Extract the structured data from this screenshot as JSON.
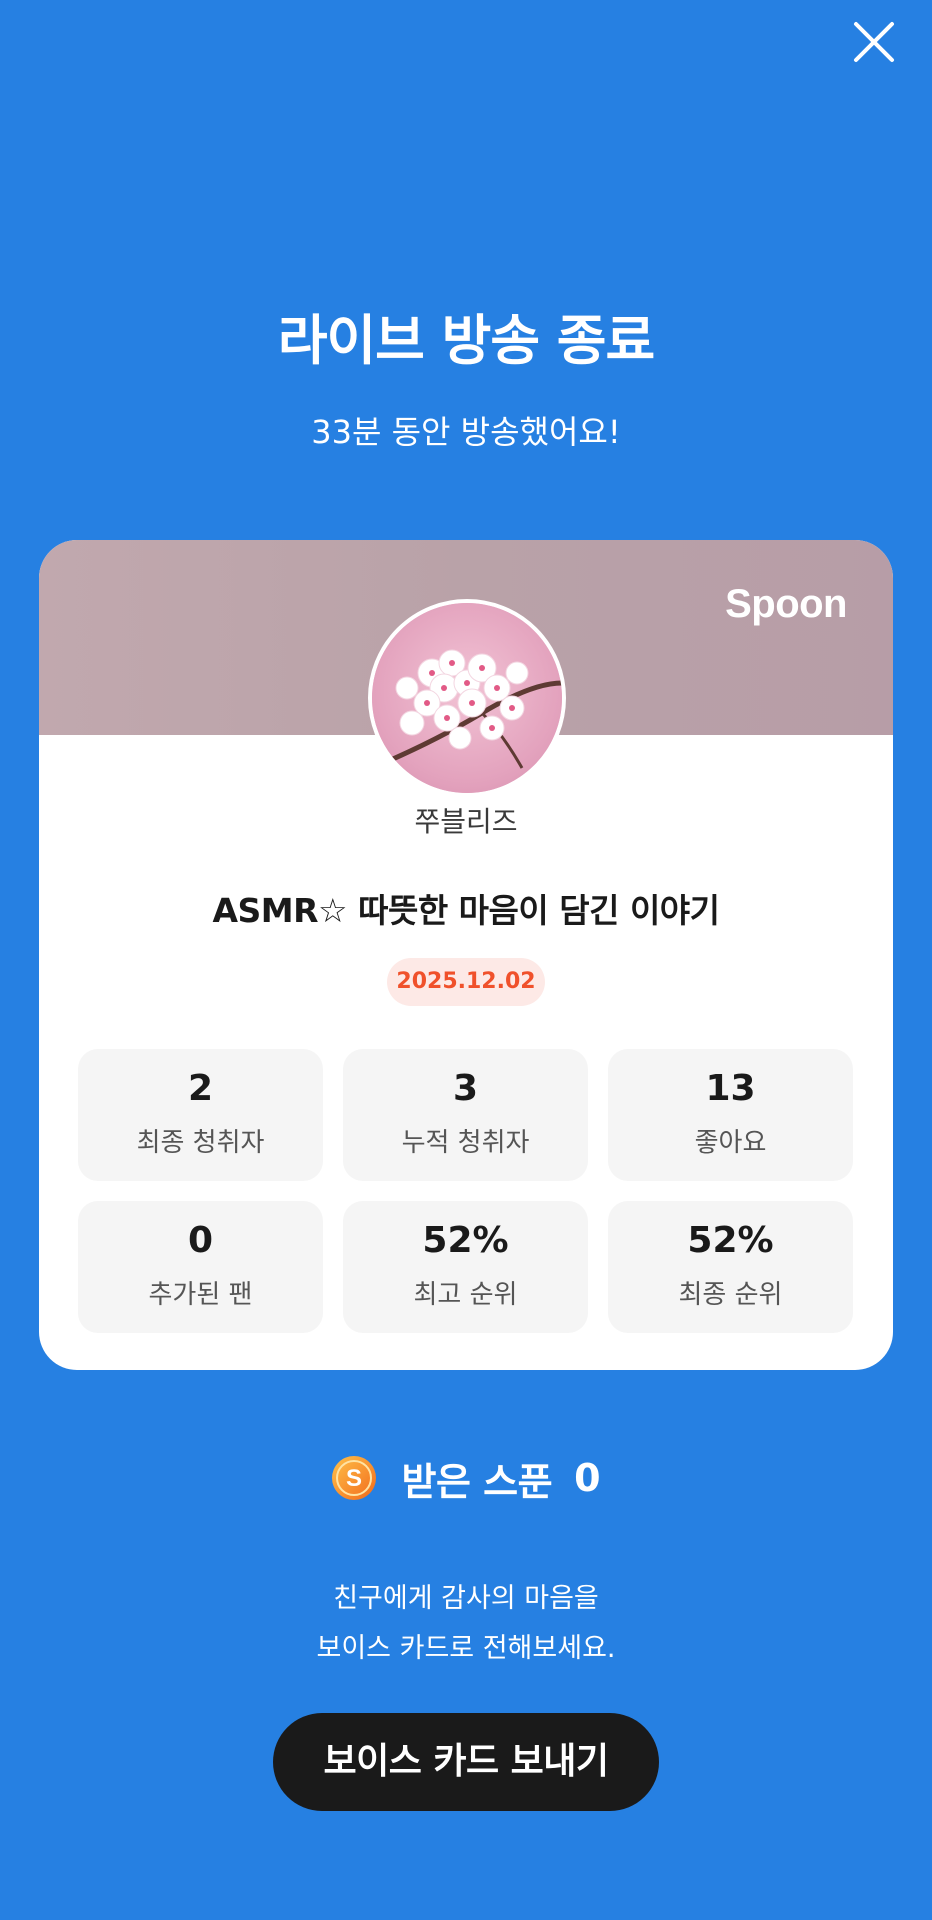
{
  "close_icon": "close-icon",
  "header": {
    "title": "라이브 방송 종료",
    "subtitle": "33분 동안 방송했어요!"
  },
  "card": {
    "brand": "Spoon",
    "avatar_icon": "cherry-blossom-avatar",
    "nickname": "쭈블리즈",
    "live_title": "ASMR☆ 따뜻한 마음이 담긴 이야기",
    "date": "2025.12.02",
    "date_color": "#F0512B",
    "stats": [
      {
        "value": "2",
        "label": "최종 청취자"
      },
      {
        "value": "3",
        "label": "누적 청취자"
      },
      {
        "value": "13",
        "label": "좋아요"
      },
      {
        "value": "0",
        "label": "추가된 팬"
      },
      {
        "value": "52%",
        "label": "최고 순위"
      },
      {
        "value": "52%",
        "label": "최종 순위"
      }
    ]
  },
  "spoon": {
    "icon": "spoon-coin-icon",
    "label": "받은 스푼",
    "count": "0"
  },
  "message": {
    "line1": "친구에게 감사의 마음을",
    "line2": "보이스 카드로 전해보세요."
  },
  "cta": {
    "label": "보이스 카드 보내기"
  },
  "colors": {
    "background": "#2680E2",
    "card": "#FFFFFF",
    "stat_tile": "#F5F5F5",
    "cta": "#1A1A1A"
  }
}
